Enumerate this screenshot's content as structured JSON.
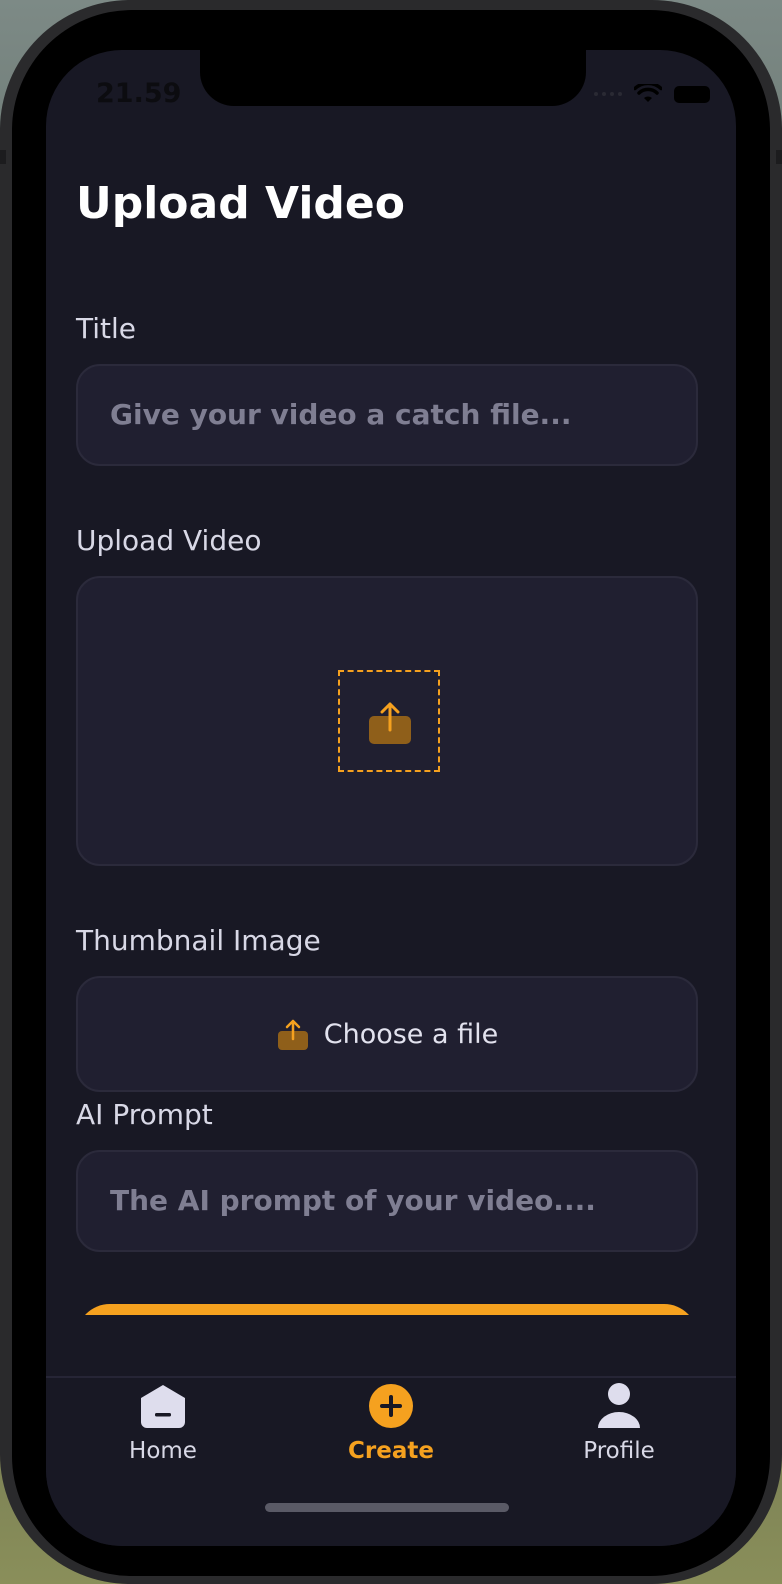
{
  "status": {
    "time": "21.59"
  },
  "page": {
    "title": "Upload Video"
  },
  "form": {
    "title_label": "Title",
    "title_placeholder": "Give your video a catch file...",
    "video_label": "Upload Video",
    "thumbnail_label": "Thumbnail Image",
    "thumbnail_button": "Choose a file",
    "prompt_label": "AI Prompt",
    "prompt_placeholder": "The AI prompt of your video...."
  },
  "tabs": [
    {
      "label": "Home",
      "icon": "home-icon",
      "active": false
    },
    {
      "label": "Create",
      "icon": "plus-circle-icon",
      "active": true
    },
    {
      "label": "Profile",
      "icon": "user-icon",
      "active": false
    }
  ],
  "colors": {
    "accent": "#f5a11f",
    "background": "#181824",
    "field": "#201f30"
  }
}
